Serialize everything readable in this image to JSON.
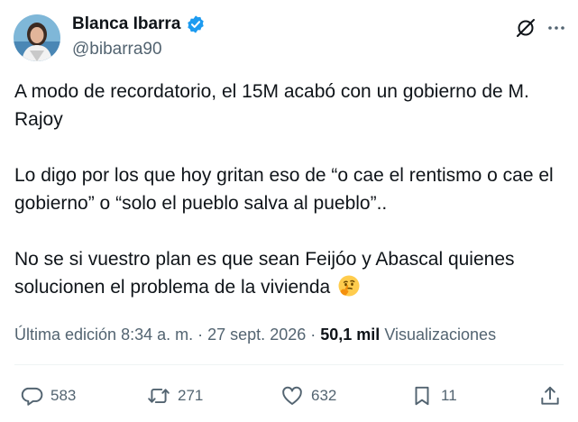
{
  "author": {
    "display_name": "Blanca Ibarra",
    "handle": "@bibarra90"
  },
  "tweet": {
    "paragraphs": [
      "A modo de recordatorio, el 15M acabó con un gobierno de M. Rajoy",
      "Lo digo por los que hoy gritan eso de “o cae el rentismo o cae el gobierno” o “solo el pueblo salva al pueblo”..",
      "No se si vuestro plan es que sean Feijóo y Abascal quienes solucionen el problema de la vivienda"
    ],
    "emoji": "thinking-face-emoji"
  },
  "meta": {
    "edited_prefix": "Última edición",
    "time": "8:34 a. m.",
    "separator": "·",
    "date": "27 sept. 2026",
    "views_count": "50,1 mil",
    "views_label": "Visualizaciones"
  },
  "actions": {
    "replies": "583",
    "reposts": "271",
    "likes": "632",
    "bookmarks": "11"
  },
  "colors": {
    "text": "#0f1419",
    "secondary": "#536471",
    "verified": "#1d9bf0",
    "divider": "#eff3f4"
  }
}
